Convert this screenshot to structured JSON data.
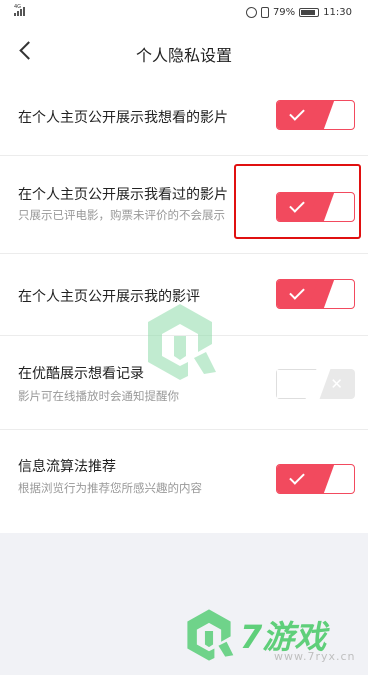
{
  "status_bar": {
    "network": "4G",
    "battery": "79%",
    "time": "11:30"
  },
  "nav": {
    "title": "个人隐私设置"
  },
  "settings": [
    {
      "label": "在个人主页公开展示我想看的影片",
      "sub": "",
      "enabled": true
    },
    {
      "label": "在个人主页公开展示我看过的影片",
      "sub": "只展示已评电影，购票未评价的不会展示",
      "enabled": true
    },
    {
      "label": "在个人主页公开展示我的影评",
      "sub": "",
      "enabled": true
    },
    {
      "label": "在优酷展示想看记录",
      "sub": "影片可在线播放时会通知提醒你",
      "enabled": false
    },
    {
      "label": "信息流算法推荐",
      "sub": "根据浏览行为推荐您所感兴趣的内容",
      "enabled": true
    }
  ],
  "watermark": {
    "brand": "7游戏",
    "url": "www.7ryx.cn"
  },
  "colors": {
    "accent": "#f24a5e",
    "highlight": "#e01010",
    "watermark": "#5fcf7a"
  }
}
